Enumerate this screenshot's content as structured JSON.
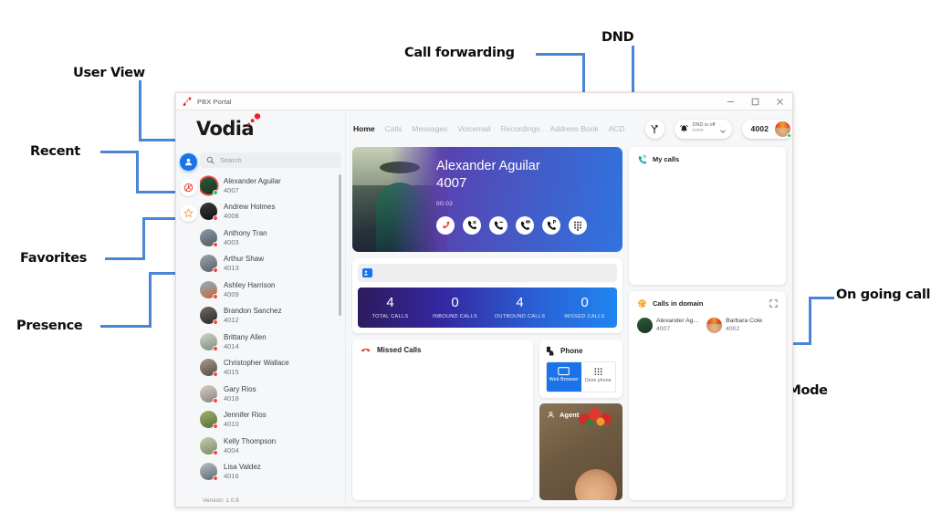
{
  "annotations": [
    {
      "id": "user-view",
      "label": "User View"
    },
    {
      "id": "recent",
      "label": "Recent"
    },
    {
      "id": "favorites",
      "label": "Favorites"
    },
    {
      "id": "presence",
      "label": "Presence"
    },
    {
      "id": "call-forwarding",
      "label": "Call forwarding"
    },
    {
      "id": "dnd",
      "label": "DND"
    },
    {
      "id": "ongoing-call",
      "label": "Ongoing call"
    },
    {
      "id": "on-going-call",
      "label": "On going call"
    },
    {
      "id": "softmode-cti",
      "label": "Softmode or CTI Mode"
    }
  ],
  "window": {
    "title": "PBX Portal",
    "minimize": "–",
    "maximize": "☐",
    "close": "✕"
  },
  "brand": {
    "name": "Vodia"
  },
  "rail": {
    "items": [
      {
        "icon": "user-view-icon",
        "name": "user-view",
        "active": true
      },
      {
        "icon": "recent-history-icon",
        "name": "recent",
        "active": false
      },
      {
        "icon": "favorites-star-icon",
        "name": "favorites",
        "active": false
      }
    ]
  },
  "search": {
    "placeholder": "Search",
    "icon": "search-icon"
  },
  "contacts": [
    {
      "name": "Alexander Aguilar",
      "ext": "4007",
      "presence": "online",
      "ringed": true
    },
    {
      "name": "Andrew Holmes",
      "ext": "4008",
      "presence": "busy",
      "ringed": false
    },
    {
      "name": "Anthony Tran",
      "ext": "4003",
      "presence": "busy",
      "ringed": false
    },
    {
      "name": "Arthur Shaw",
      "ext": "4013",
      "presence": "busy",
      "ringed": false
    },
    {
      "name": "Ashley Harrison",
      "ext": "4009",
      "presence": "busy",
      "ringed": false
    },
    {
      "name": "Brandon Sanchez",
      "ext": "4012",
      "presence": "busy",
      "ringed": false
    },
    {
      "name": "Brittany Allen",
      "ext": "4014",
      "presence": "busy",
      "ringed": false
    },
    {
      "name": "Christopher Wallace",
      "ext": "4015",
      "presence": "busy",
      "ringed": false
    },
    {
      "name": "Gary Rios",
      "ext": "4018",
      "presence": "busy",
      "ringed": false
    },
    {
      "name": "Jennifer Rios",
      "ext": "4010",
      "presence": "busy",
      "ringed": false
    },
    {
      "name": "Kelly Thompson",
      "ext": "4004",
      "presence": "busy",
      "ringed": false
    },
    {
      "name": "Lisa Valdez",
      "ext": "4016",
      "presence": "busy",
      "ringed": false
    }
  ],
  "version_label": "Version: 1.0.8",
  "nav": {
    "tabs": [
      {
        "label": "Home",
        "active": true
      },
      {
        "label": "Calls",
        "active": false
      },
      {
        "label": "Messages",
        "active": false
      },
      {
        "label": "Voicemail",
        "active": false
      },
      {
        "label": "Recordings",
        "active": false
      },
      {
        "label": "Address Book",
        "active": false
      },
      {
        "label": "ACD",
        "active": false
      }
    ],
    "call_forwarding_icon": "call-forwarding-icon",
    "dnd": {
      "icon": "bell-icon",
      "status": "DND is off",
      "selected": "none",
      "chevron": "chevron-down-icon"
    },
    "my_extension": "4002"
  },
  "call_card": {
    "name": "Alexander Aguilar",
    "extension": "4007",
    "duration": "00:02",
    "actions": [
      {
        "name": "hangup-button",
        "icon": "phone-hangup-icon"
      },
      {
        "name": "hold-button",
        "icon": "phone-pause-icon"
      },
      {
        "name": "transfer-button",
        "icon": "phone-transfer-icon"
      },
      {
        "name": "conference-button",
        "icon": "phone-conference-icon"
      },
      {
        "name": "park-button",
        "icon": "phone-park-icon"
      },
      {
        "name": "keypad-button",
        "icon": "keypad-icon"
      }
    ]
  },
  "contact_strip": {
    "icon": "contact-card-icon"
  },
  "stats": [
    {
      "value": "4",
      "label": "TOTAL CALLS"
    },
    {
      "value": "0",
      "label": "INBOUND CALLS"
    },
    {
      "value": "4",
      "label": "OUTBOUND CALLS"
    },
    {
      "value": "0",
      "label": "MISSED CALLS"
    }
  ],
  "missed_calls": {
    "title": "Missed Calls",
    "icon": "missed-call-icon"
  },
  "phone_panel": {
    "title": "Phone",
    "icon": "phone-hand-icon",
    "modes": [
      {
        "label": "Web Browser",
        "icon": "monitor-icon",
        "selected": true
      },
      {
        "label": "Desk phone",
        "icon": "keypad-icon",
        "selected": false
      }
    ]
  },
  "agent_card": {
    "title": "Agent",
    "icon": "person-icon"
  },
  "my_calls": {
    "title": "My calls",
    "icon": "phone-calls-icon"
  },
  "calls_in_domain": {
    "title": "Calls in domain",
    "icon": "globe-icon",
    "expand_icon": "expand-icon",
    "parties": [
      {
        "name": "Alexander Ag...",
        "ext": "4007"
      },
      {
        "name": "Barbara Cole",
        "ext": "4002"
      }
    ]
  },
  "colors": {
    "accent_blue": "#1a73e8",
    "annotation_line": "#4a86d8",
    "brand_red": "#ee1d25",
    "presence_online": "#22c55e",
    "presence_busy": "#f5453f"
  }
}
